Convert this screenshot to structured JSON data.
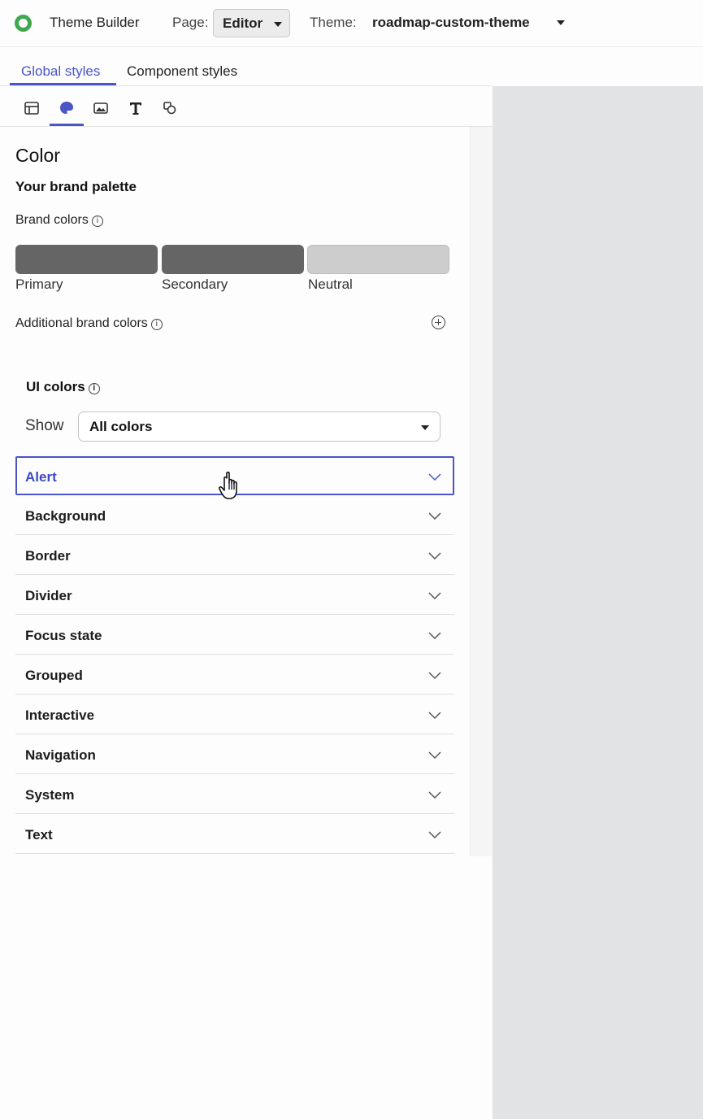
{
  "header": {
    "app_title": "Theme Builder",
    "page_label": "Page:",
    "page_value": "Editor",
    "theme_label": "Theme:",
    "theme_value": "roadmap-custom-theme"
  },
  "tabs": {
    "global": "Global styles",
    "component": "Component styles"
  },
  "icon_toolbar": [
    "layout-icon",
    "palette-icon",
    "image-icon",
    "typography-icon",
    "shapes-icon"
  ],
  "color_section": {
    "title": "Color",
    "palette_title": "Your brand palette",
    "brand_colors_label": "Brand colors",
    "swatches": [
      {
        "label": "Primary",
        "color": "#656565"
      },
      {
        "label": "Secondary",
        "color": "#656565"
      },
      {
        "label": "Neutral",
        "color": "#cdcdcd"
      }
    ],
    "additional_label": "Additional brand colors"
  },
  "ui_colors": {
    "title": "UI colors",
    "show_label": "Show",
    "show_value": "All colors",
    "categories": [
      "Alert",
      "Background",
      "Border",
      "Divider",
      "Focus state",
      "Grouped",
      "Interactive",
      "Navigation",
      "System",
      "Text"
    ],
    "active_category": "Alert"
  },
  "colors": {
    "accent": "#4a55c8",
    "logo": "#3fa84f",
    "canvas": "#e2e3e5"
  }
}
